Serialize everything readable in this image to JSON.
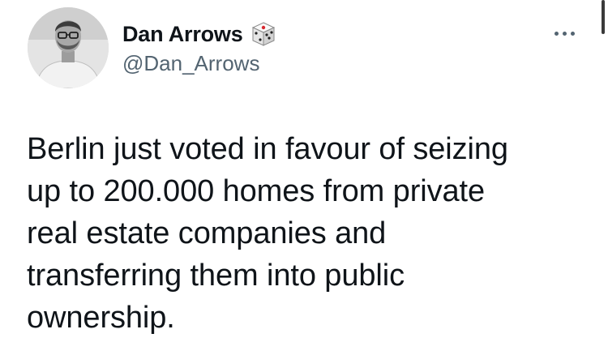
{
  "tweet": {
    "author": {
      "display_name": "Dan Arrows",
      "handle": "@Dan_Arrows",
      "name_emoji_icon": "dice-icon",
      "avatar_icon": "user-avatar"
    },
    "more_menu_icon": "ellipsis-icon",
    "text": "Berlin just voted in favour of seizing\nup to 200.000 homes from private\nreal estate companies and\ntransferring them into public\nownership."
  },
  "colors": {
    "text_primary": "#0f1419",
    "text_secondary": "#536471",
    "background": "#ffffff"
  }
}
